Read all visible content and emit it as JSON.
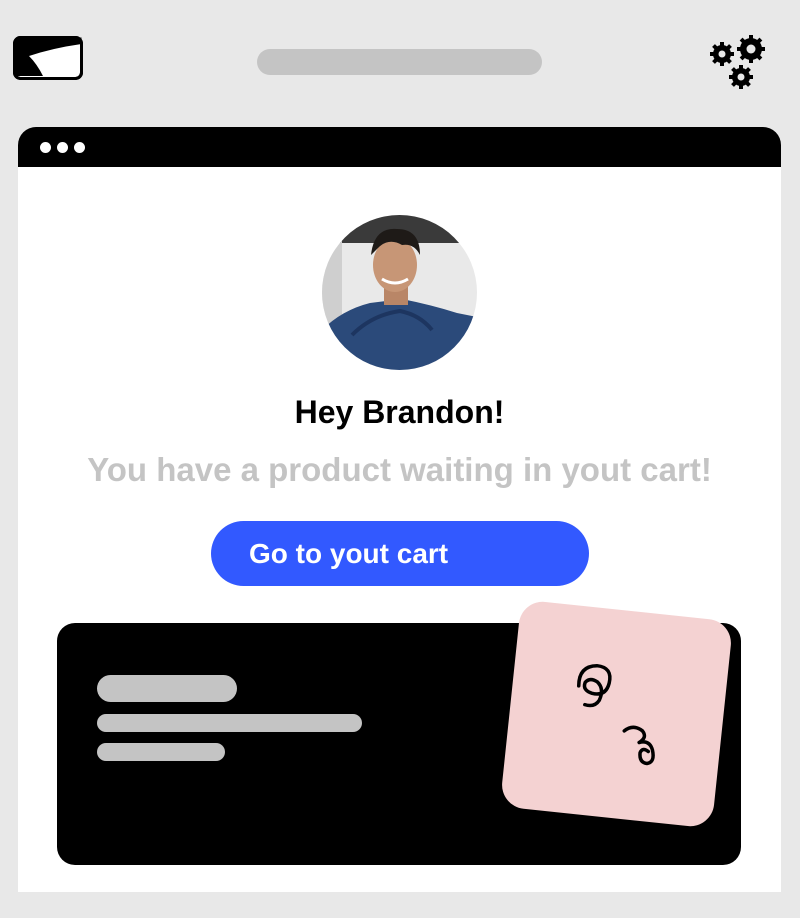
{
  "top_bar": {
    "mail_icon": "mail-icon",
    "settings_icon": "gears-icon"
  },
  "browser": {
    "window_controls": [
      "dot",
      "dot",
      "dot"
    ]
  },
  "message": {
    "greeting": "Hey Brandon!",
    "subtitle": "You have a product waiting in yout cart!",
    "cta_label": "Go to yout cart"
  },
  "colors": {
    "background": "#e8e8e8",
    "cta": "#3259ff",
    "subtitle": "#c4c4c4",
    "card": "#000000",
    "sticky_note": "#f4d2d2"
  }
}
